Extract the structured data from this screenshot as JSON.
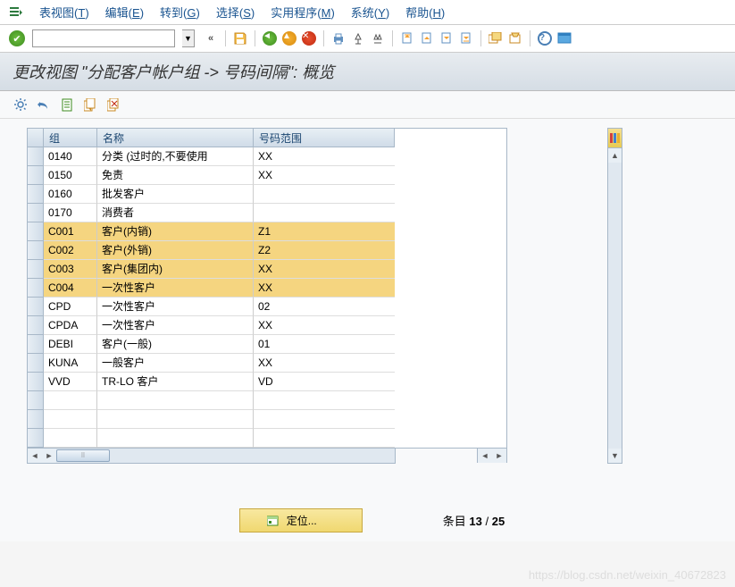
{
  "menu": {
    "items": [
      {
        "label": "表视图",
        "key": "T"
      },
      {
        "label": "编辑",
        "key": "E"
      },
      {
        "label": "转到",
        "key": "G"
      },
      {
        "label": "选择",
        "key": "S"
      },
      {
        "label": "实用程序",
        "key": "M"
      },
      {
        "label": "系统",
        "key": "Y"
      },
      {
        "label": "帮助",
        "key": "H"
      }
    ]
  },
  "commandField": {
    "value": "",
    "placeholder": ""
  },
  "title": "更改视图 \"分配客户帐户组 -> 号码间隔\": 概览",
  "columns": {
    "group": "组",
    "name": "名称",
    "range": "号码范围"
  },
  "rows": [
    {
      "group": "0140",
      "name": "分类 (过时的,不要使用",
      "range": "XX",
      "hl": false
    },
    {
      "group": "0150",
      "name": "免责",
      "range": "XX",
      "hl": false
    },
    {
      "group": "0160",
      "name": "批发客户",
      "range": "",
      "hl": false
    },
    {
      "group": "0170",
      "name": "消费者",
      "range": "",
      "hl": false
    },
    {
      "group": "C001",
      "name": "客户(内销)",
      "range": "Z1",
      "hl": true
    },
    {
      "group": "C002",
      "name": "客户(外销)",
      "range": "Z2",
      "hl": true
    },
    {
      "group": "C003",
      "name": "客户(集团内)",
      "range": "XX",
      "hl": true
    },
    {
      "group": "C004",
      "name": "一次性客户",
      "range": "XX",
      "hl": true,
      "corner": true
    },
    {
      "group": "CPD",
      "name": "一次性客户",
      "range": "02",
      "hl": false
    },
    {
      "group": "CPDA",
      "name": "一次性客户",
      "range": "XX",
      "hl": false
    },
    {
      "group": "DEBI",
      "name": "客户(一般)",
      "range": "01",
      "hl": false
    },
    {
      "group": "KUNA",
      "name": "一般客户",
      "range": "XX",
      "hl": false
    },
    {
      "group": "VVD",
      "name": "TR-LO 客户",
      "range": "VD",
      "hl": false
    },
    {
      "group": "",
      "name": "",
      "range": "",
      "hl": false
    },
    {
      "group": "",
      "name": "",
      "range": "",
      "hl": false
    },
    {
      "group": "",
      "name": "",
      "range": "",
      "hl": false
    }
  ],
  "positionButton": {
    "label": "定位..."
  },
  "entries": {
    "prefix": "条目",
    "current": "13",
    "sep": "/",
    "total": "25"
  },
  "watermark": "https://blog.csdn.net/weixin_40672823"
}
